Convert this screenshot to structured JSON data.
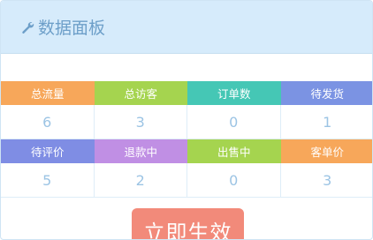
{
  "panel": {
    "title": "数据面板",
    "icon": "wrench-icon"
  },
  "stats_row1": [
    {
      "label": "总流量",
      "value": "6",
      "color": "#f7a75a"
    },
    {
      "label": "总访客",
      "value": "3",
      "color": "#a5d44f"
    },
    {
      "label": "订单数",
      "value": "0",
      "color": "#45c7b5"
    },
    {
      "label": "待发货",
      "value": "1",
      "color": "#7b93e3"
    }
  ],
  "stats_row2": [
    {
      "label": "待评价",
      "value": "5",
      "color": "#7f8de4"
    },
    {
      "label": "退款中",
      "value": "2",
      "color": "#c08fe4"
    },
    {
      "label": "出售中",
      "value": "0",
      "color": "#a5d44f"
    },
    {
      "label": "客单价",
      "value": "3",
      "color": "#f7a75a"
    }
  ],
  "actions": {
    "apply_label": "立即生效",
    "apply_color": "#f28a7a"
  }
}
